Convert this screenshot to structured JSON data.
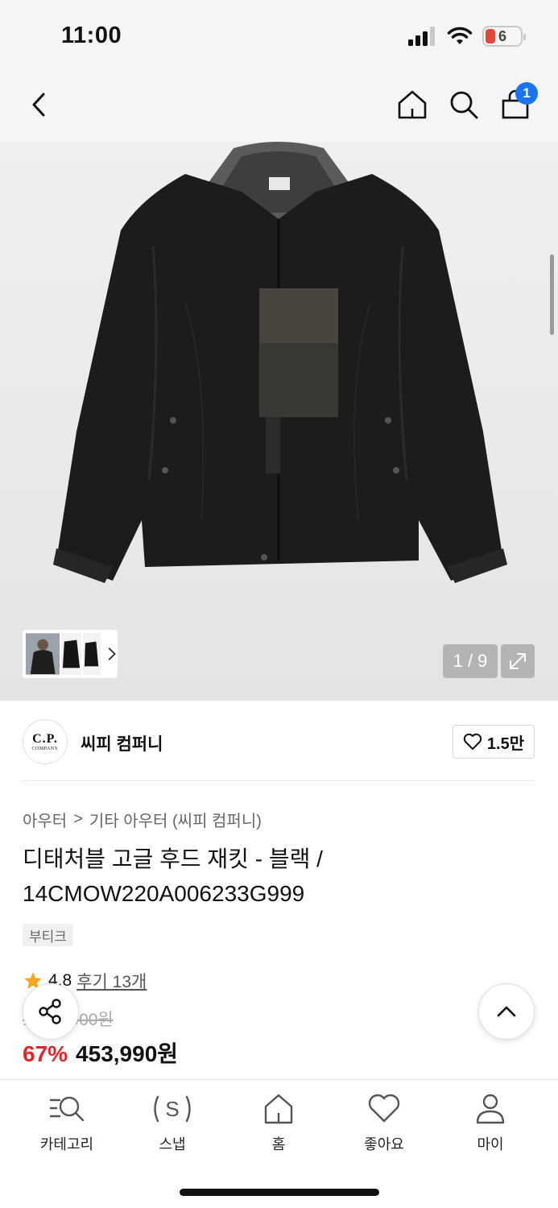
{
  "status_bar": {
    "time": "11:00",
    "battery": "6"
  },
  "nav": {
    "cart_count": "1",
    "back_icon": "chevron-left-icon",
    "home_icon": "home-icon",
    "search_icon": "search-icon",
    "cart_icon": "shopping-bag-icon"
  },
  "gallery": {
    "counter": "1 / 9"
  },
  "brand": {
    "logo_big": "C.P.",
    "logo_small": "COMPANY",
    "name": "씨피 컴퍼니",
    "likes": "1.5만"
  },
  "breadcrumb": {
    "level1": "아우터",
    "separator": ">",
    "level2": "기타 아우터 (씨피 컴퍼니)"
  },
  "product": {
    "title": "디태처블 고글 후드 재킷 - 블랙 / 14CMOW220A006233G999",
    "tag": "부티크",
    "rating": "4.8",
    "reviews": "후기 13개",
    "original_price": "1,360,900원",
    "discount": "67%",
    "price": "453,990원"
  },
  "tab_bar": {
    "tabs": [
      {
        "label": "카테고리",
        "icon": "category-search-icon"
      },
      {
        "label": "스냅",
        "icon": "snap-icon"
      },
      {
        "label": "홈",
        "icon": "home-icon"
      },
      {
        "label": "좋아요",
        "icon": "heart-icon"
      },
      {
        "label": "마이",
        "icon": "person-icon"
      }
    ]
  },
  "colors": {
    "accent_blue": "#1a73f0",
    "discount_red": "#e2252b",
    "star": "#f5a623"
  }
}
